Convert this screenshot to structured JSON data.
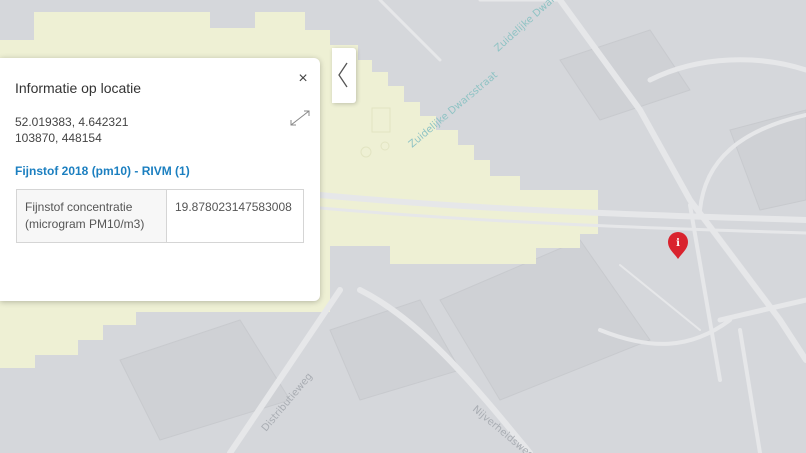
{
  "map": {
    "street_labels": [
      "Zuidelijke Dwarsstraat",
      "Distributieweg",
      "Nijverheidsweg"
    ],
    "marker_icon": "info-marker-icon",
    "colors": {
      "pm10_zone": "#eef0d4",
      "marker": "#d9232e",
      "background": "#d5d7db"
    }
  },
  "panel": {
    "title": "Informatie op locatie",
    "close_icon": "×",
    "latlon": "52.019383, 4.642321",
    "rd": "103870, 448154",
    "layer_link": "Fijnstof 2018 (pm10) - RIVM (1)",
    "attributes": [
      {
        "label": "Fijnstof concentratie (microgram PM10/m3)",
        "value": "19.878023147583008"
      }
    ]
  }
}
